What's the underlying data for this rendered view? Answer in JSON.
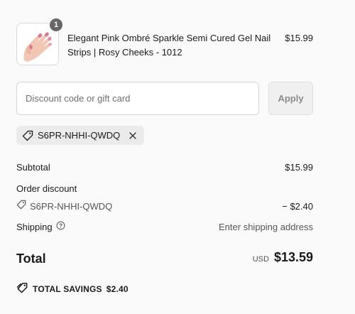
{
  "cart": {
    "item": {
      "quantity": "1",
      "title": "Elegant Pink Ombré Sparkle Semi Cured Gel Nail Strips | Rosy Cheeks - 1012",
      "price": "$15.99",
      "image_icon": "nail-strips-product-photo"
    }
  },
  "discount": {
    "placeholder": "Discount code or gift card",
    "value": "",
    "apply_label": "Apply",
    "applied_code": "S6PR-NHHI-QWDQ",
    "tag_icon": "tag-icon",
    "remove_icon": "close-icon"
  },
  "summary": {
    "subtotal_label": "Subtotal",
    "subtotal_value": "$15.99",
    "order_discount_label": "Order discount",
    "discount_code": "S6PR-NHHI-QWDQ",
    "discount_value": "− $2.40",
    "shipping_label": "Shipping",
    "shipping_help_icon": "help-circle-icon",
    "shipping_value": "Enter shipping address",
    "total_label": "Total",
    "currency": "USD",
    "total_value": "$13.59",
    "savings_label": "TOTAL SAVINGS",
    "savings_value": "$2.40"
  },
  "colors": {
    "background": "#fafafa",
    "text": "#1a1a1a",
    "muted": "#555555",
    "badge": "#666666",
    "chip": "#ebebeb"
  }
}
